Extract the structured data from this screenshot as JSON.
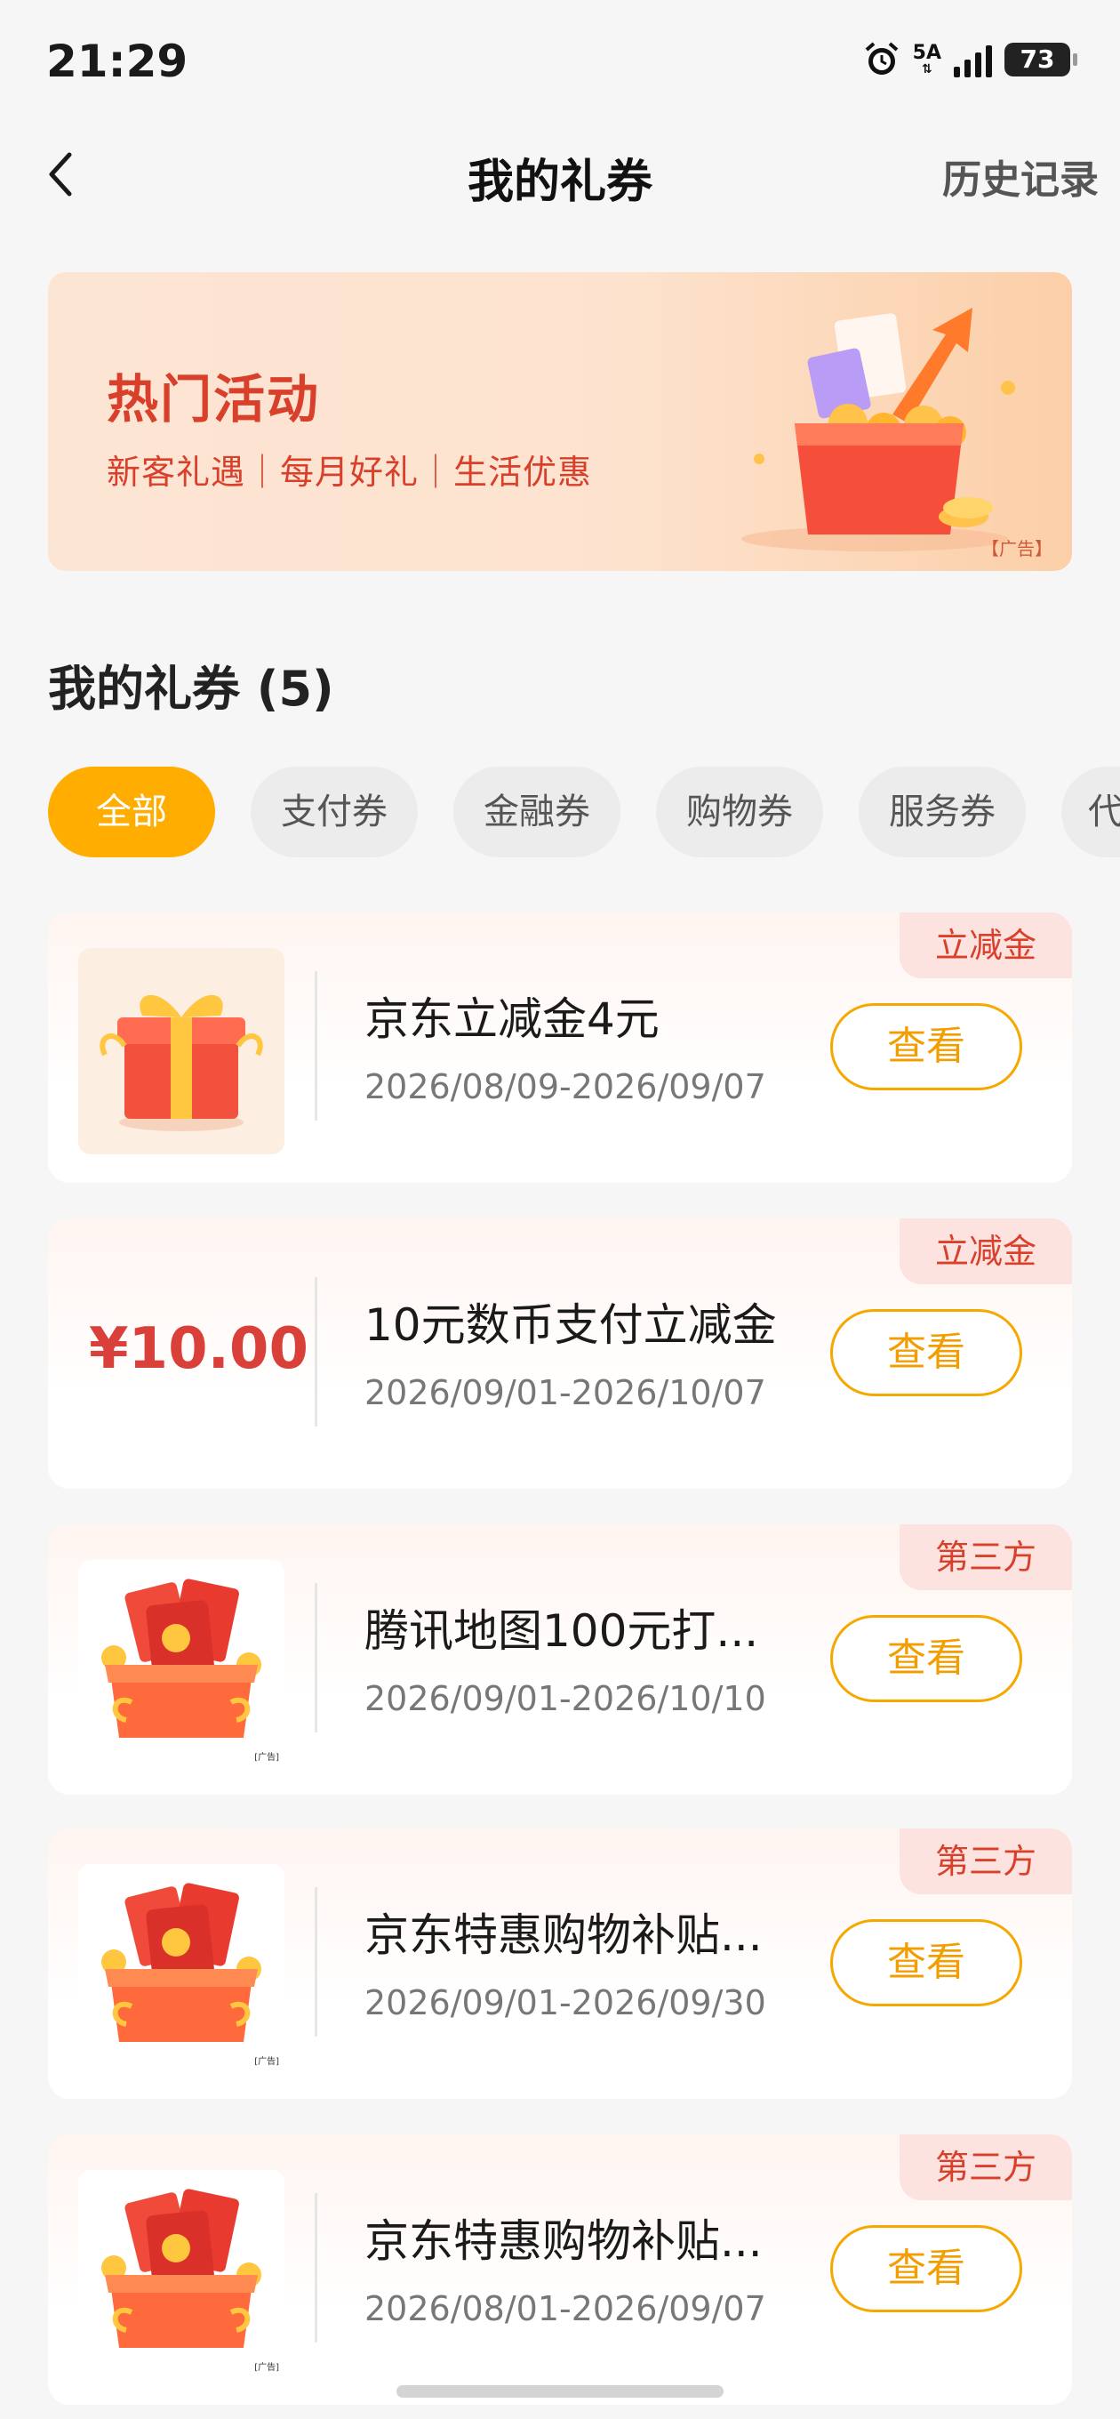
{
  "status_bar": {
    "time": "21:29",
    "network": "5A",
    "battery": "73"
  },
  "nav": {
    "title": "我的礼券",
    "history": "历史记录"
  },
  "banner": {
    "title": "热门活动",
    "subtitle": "新客礼遇｜每月好礼｜生活优惠",
    "ad_label": "【广告】"
  },
  "section": {
    "title": "我的礼券 (5)"
  },
  "tabs": [
    {
      "label": "全部",
      "active": true
    },
    {
      "label": "支付券"
    },
    {
      "label": "金融券"
    },
    {
      "label": "购物券"
    },
    {
      "label": "服务券"
    },
    {
      "label": "代"
    }
  ],
  "coupons": [
    {
      "tag": "立减金",
      "name": "京东立减金4元",
      "date": "2026/08/09-2026/09/07",
      "button": "查看",
      "thumb": "gift-box-icon"
    },
    {
      "tag": "立减金",
      "name": "10元数币支付立减金",
      "date": "2026/09/01-2026/10/07",
      "button": "查看",
      "amount": "¥10.00"
    },
    {
      "tag": "第三方",
      "name": "腾讯地图100元打...",
      "date": "2026/09/01-2026/10/10",
      "button": "查看",
      "thumb": "red-envelope-box-icon",
      "ad_label": "[广告]"
    },
    {
      "tag": "第三方",
      "name": "京东特惠购物补贴...",
      "date": "2026/09/01-2026/09/30",
      "button": "查看",
      "thumb": "red-envelope-box-icon",
      "ad_label": "[广告]"
    },
    {
      "tag": "第三方",
      "name": "京东特惠购物补贴...",
      "date": "2026/08/01-2026/09/07",
      "button": "查看",
      "thumb": "red-envelope-box-icon",
      "ad_label": "[广告]"
    }
  ],
  "colors": {
    "accent": "#ffad00",
    "tag_red": "#d9402b",
    "amount_red": "#d9403a"
  }
}
